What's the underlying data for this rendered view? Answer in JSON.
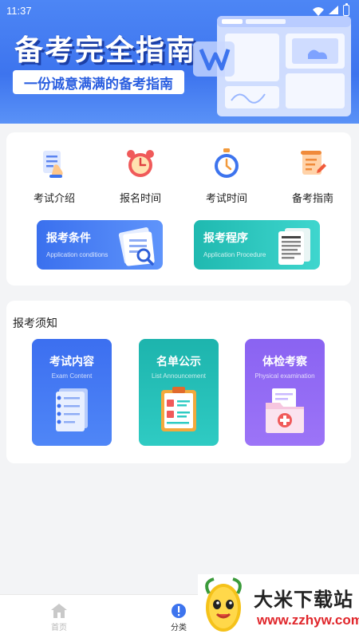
{
  "status_bar": {
    "time": "11:37"
  },
  "banner": {
    "title": "备考完全指南",
    "subtitle": "一份诚意满满的备考指南"
  },
  "quick_links": [
    {
      "label": "考试介绍",
      "icon": "document-hand-icon"
    },
    {
      "label": "报名时间",
      "icon": "alarm-clock-icon"
    },
    {
      "label": "考试时间",
      "icon": "stopwatch-icon"
    },
    {
      "label": "备考指南",
      "icon": "scroll-pencil-icon"
    }
  ],
  "features": [
    {
      "title": "报考条件",
      "subtitle": "Application conditions",
      "icon": "document-magnifier-icon"
    },
    {
      "title": "报考程序",
      "subtitle": "Application Procedure",
      "icon": "document-stack-icon"
    }
  ],
  "notice": {
    "title": "报考须知",
    "cards": [
      {
        "title": "考试内容",
        "subtitle": "Exam Content",
        "icon": "notebook-icon"
      },
      {
        "title": "名单公示",
        "subtitle": "List Announcement",
        "icon": "clipboard-icon"
      },
      {
        "title": "体检考察",
        "subtitle": "Physical examination",
        "icon": "medical-folder-icon"
      }
    ]
  },
  "bottom_nav": {
    "home_label": "首页",
    "category_label": "分类"
  },
  "watermark": {
    "title": "大米下载站",
    "url": "www.zzhyw.com"
  },
  "colors": {
    "banner_blue": "#3d74ee",
    "feature_blue": "#3a70ee",
    "feature_teal": "#1fb9b0",
    "notice_purple": "#8a63f2",
    "watermark_red": "#e0262b"
  }
}
